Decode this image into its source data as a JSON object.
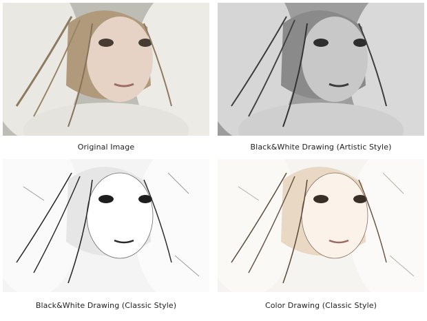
{
  "gallery": {
    "items": [
      {
        "caption": "Original Image",
        "style": "photo"
      },
      {
        "caption": "Black&White Drawing (Artistic Style)",
        "style": "bw-artistic"
      },
      {
        "caption": "Black&White Drawing (Classic Style)",
        "style": "bw-classic"
      },
      {
        "caption": "Color Drawing (Classic Style)",
        "style": "color-classic"
      }
    ]
  }
}
